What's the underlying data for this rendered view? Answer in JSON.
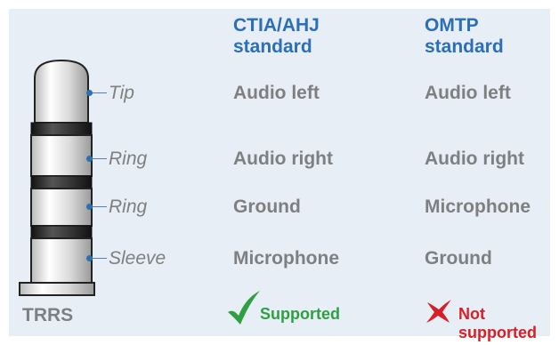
{
  "headers": {
    "ctia_line1": "CTIA/AHJ",
    "ctia_line2": "standard",
    "omtp_line1": "OMTP",
    "omtp_line2": "standard"
  },
  "connector_label": "TRRS",
  "rows": [
    {
      "contact": "Tip",
      "ctia": "Audio left",
      "omtp": "Audio left"
    },
    {
      "contact": "Ring",
      "ctia": "Audio right",
      "omtp": "Audio right"
    },
    {
      "contact": "Ring",
      "ctia": "Ground",
      "omtp": "Microphone"
    },
    {
      "contact": "Sleeve",
      "ctia": "Microphone",
      "omtp": "Ground"
    }
  ],
  "support": {
    "ctia_status": "Supported",
    "omtp_line1": "Not",
    "omtp_line2": "supported"
  },
  "icons": {
    "ctia_status": "checkmark-icon",
    "omtp_status": "cross-icon"
  },
  "colors": {
    "panel_background": "#e8eef6",
    "header_blue": "#2b6fb8",
    "cell_gray": "#7f7f7f",
    "supported_green": "#2ea043",
    "unsupported_red": "#d61f26"
  }
}
